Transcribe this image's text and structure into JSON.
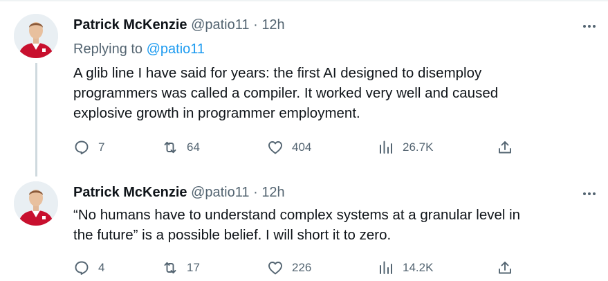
{
  "colors": {
    "text": "#0f1419",
    "secondary": "#536471",
    "link": "#1d9bf0",
    "thread_line": "#cfd9de",
    "avatar_shirt": "#c8102e"
  },
  "tweets": [
    {
      "author_name": "Patrick McKenzie",
      "handle": "@patio11",
      "separator": "·",
      "time": "12h",
      "reply_prefix": "Replying to",
      "reply_handle": "@patio11",
      "lines": [
        "A glib line I have said for years: the first AI designed to disemploy",
        "programmers was called a compiler. It worked very well and caused",
        "explosive growth in programmer employment."
      ],
      "replies": "7",
      "retweets": "64",
      "likes": "404",
      "views": "26.7K",
      "icons": [
        "reply-icon",
        "retweet-icon",
        "like-icon",
        "views-icon",
        "share-icon",
        "more-icon"
      ]
    },
    {
      "author_name": "Patrick McKenzie",
      "handle": "@patio11",
      "separator": "·",
      "time": "12h",
      "lines": [
        "“No humans have to understand complex systems at a granular level in",
        "the future” is a possible belief. I will short it to zero."
      ],
      "replies": "4",
      "retweets": "17",
      "likes": "226",
      "views": "14.2K",
      "icons": [
        "reply-icon",
        "retweet-icon",
        "like-icon",
        "views-icon",
        "share-icon",
        "more-icon"
      ]
    }
  ]
}
